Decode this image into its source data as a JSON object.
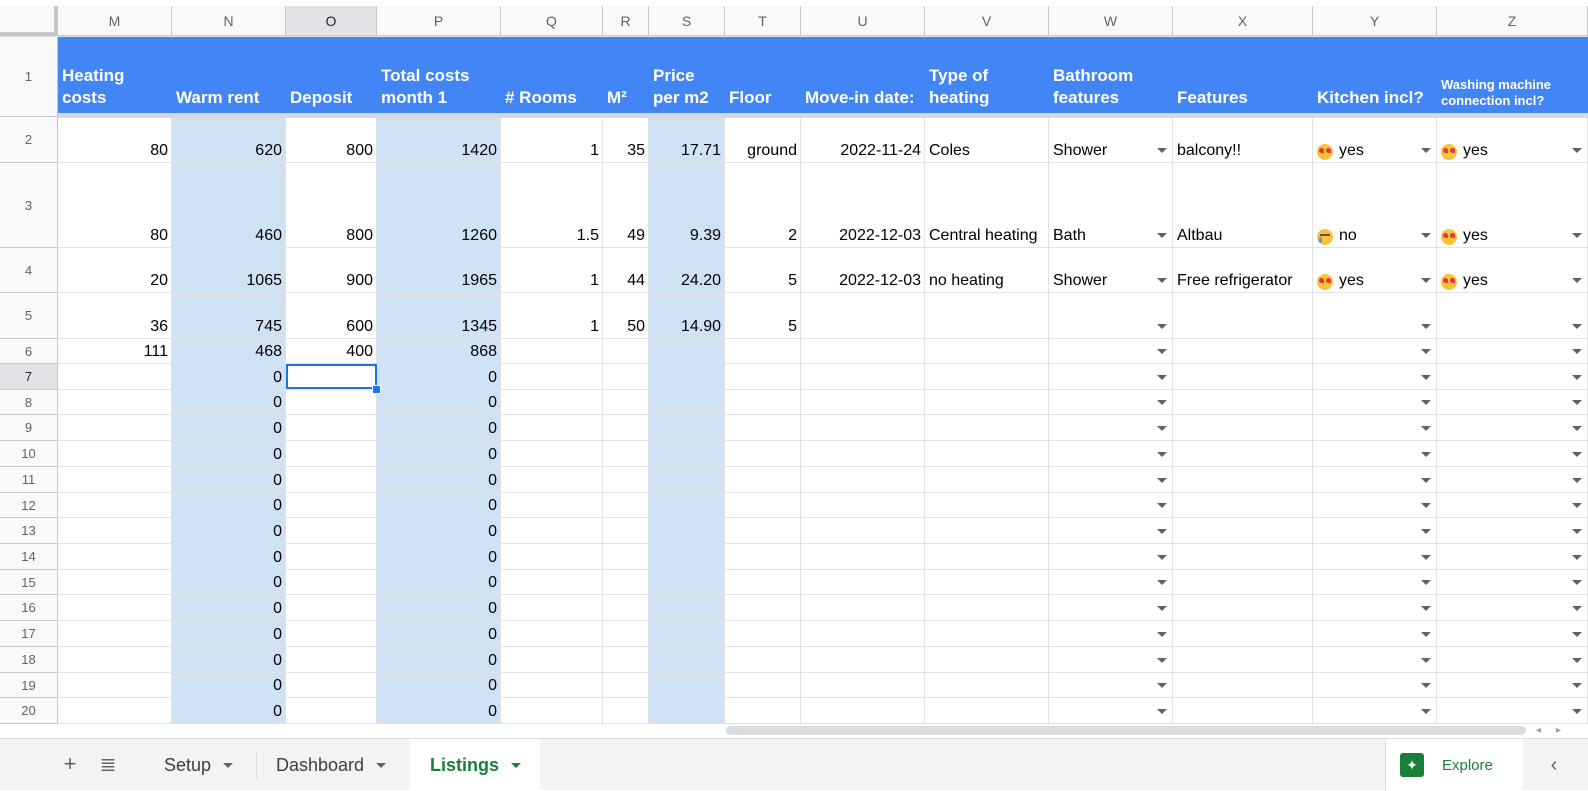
{
  "columns": [
    "M",
    "N",
    "O",
    "P",
    "Q",
    "R",
    "S",
    "T",
    "U",
    "V",
    "W",
    "X",
    "Y",
    "Z"
  ],
  "row_numbers": [
    "1",
    "2",
    "3",
    "4",
    "5",
    "6",
    "7",
    "8",
    "9",
    "10",
    "11",
    "12",
    "13",
    "14",
    "15",
    "16",
    "17",
    "18",
    "19",
    "20"
  ],
  "header": {
    "M": "Heating costs",
    "N": "Warm rent",
    "O": "Deposit",
    "P": "Total costs month 1",
    "Q": "# Rooms",
    "R": "M²",
    "S": "Price per m2",
    "T": "Floor",
    "U": "Move-in date:",
    "V": "Type of heating",
    "W": "Bathroom features",
    "X": "Features",
    "Y": "Kitchen incl?",
    "Z": "Washing machine connection incl?"
  },
  "rows": [
    {
      "M": "80",
      "N": "620",
      "O": "800",
      "P": "1420",
      "Q": "1",
      "R": "35",
      "S": "17.71",
      "T": "ground",
      "U": "2022-11-24",
      "V": "Coles",
      "W": "Shower",
      "X": "balcony!!",
      "Y": "yes",
      "Z": "yes"
    },
    {
      "M": "80",
      "N": "460",
      "O": "800",
      "P": "1260",
      "Q": "1.5",
      "R": "49",
      "S": "9.39",
      "T": "2",
      "U": "2022-12-03",
      "V": "Central heating",
      "W": "Bath",
      "X": "Altbau",
      "Y": "no",
      "Z": "yes"
    },
    {
      "M": "20",
      "N": "1065",
      "O": "900",
      "P": "1965",
      "Q": "1",
      "R": "44",
      "S": "24.20",
      "T": "5",
      "U": "2022-12-03",
      "V": "no heating",
      "W": "Shower",
      "X": "Free refrigerator",
      "Y": "yes",
      "Z": "yes"
    },
    {
      "M": "36",
      "N": "745",
      "O": "600",
      "P": "1345",
      "Q": "1",
      "R": "50",
      "S": "14.90",
      "T": "5",
      "U": "",
      "V": "",
      "W": "",
      "X": "",
      "Y": "",
      "Z": ""
    },
    {
      "M": "111",
      "N": "468",
      "O": "400",
      "P": "868",
      "Q": "",
      "R": "",
      "S": "",
      "T": "",
      "U": "",
      "V": "",
      "W": "",
      "X": "",
      "Y": "",
      "Z": ""
    },
    {
      "M": "",
      "N": "0",
      "O": "",
      "P": "0"
    },
    {
      "M": "",
      "N": "0",
      "O": "",
      "P": "0"
    },
    {
      "M": "",
      "N": "0",
      "O": "",
      "P": "0"
    },
    {
      "M": "",
      "N": "0",
      "O": "",
      "P": "0"
    },
    {
      "M": "",
      "N": "0",
      "O": "",
      "P": "0"
    },
    {
      "M": "",
      "N": "0",
      "O": "",
      "P": "0"
    },
    {
      "M": "",
      "N": "0",
      "O": "",
      "P": "0"
    },
    {
      "M": "",
      "N": "0",
      "O": "",
      "P": "0"
    },
    {
      "M": "",
      "N": "0",
      "O": "",
      "P": "0"
    },
    {
      "M": "",
      "N": "0",
      "O": "",
      "P": "0"
    },
    {
      "M": "",
      "N": "0",
      "O": "",
      "P": "0"
    },
    {
      "M": "",
      "N": "0",
      "O": "",
      "P": "0"
    },
    {
      "M": "",
      "N": "0",
      "O": "",
      "P": "0"
    },
    {
      "M": "",
      "N": "0",
      "O": "",
      "P": "0"
    }
  ],
  "emoji_icons": {
    "yes": "heart-eyes-face-icon",
    "no": "crying-cat-face-icon"
  },
  "colors": {
    "header_blue": "#4285f4",
    "lane_blue": "#cfe2f3",
    "accent_green": "#188038",
    "selection_blue": "#1a73e8"
  },
  "tabs": [
    {
      "label": "Setup",
      "active": false
    },
    {
      "label": "Dashboard",
      "active": false
    },
    {
      "label": "Listings",
      "active": true
    }
  ],
  "explore_label": "Explore"
}
